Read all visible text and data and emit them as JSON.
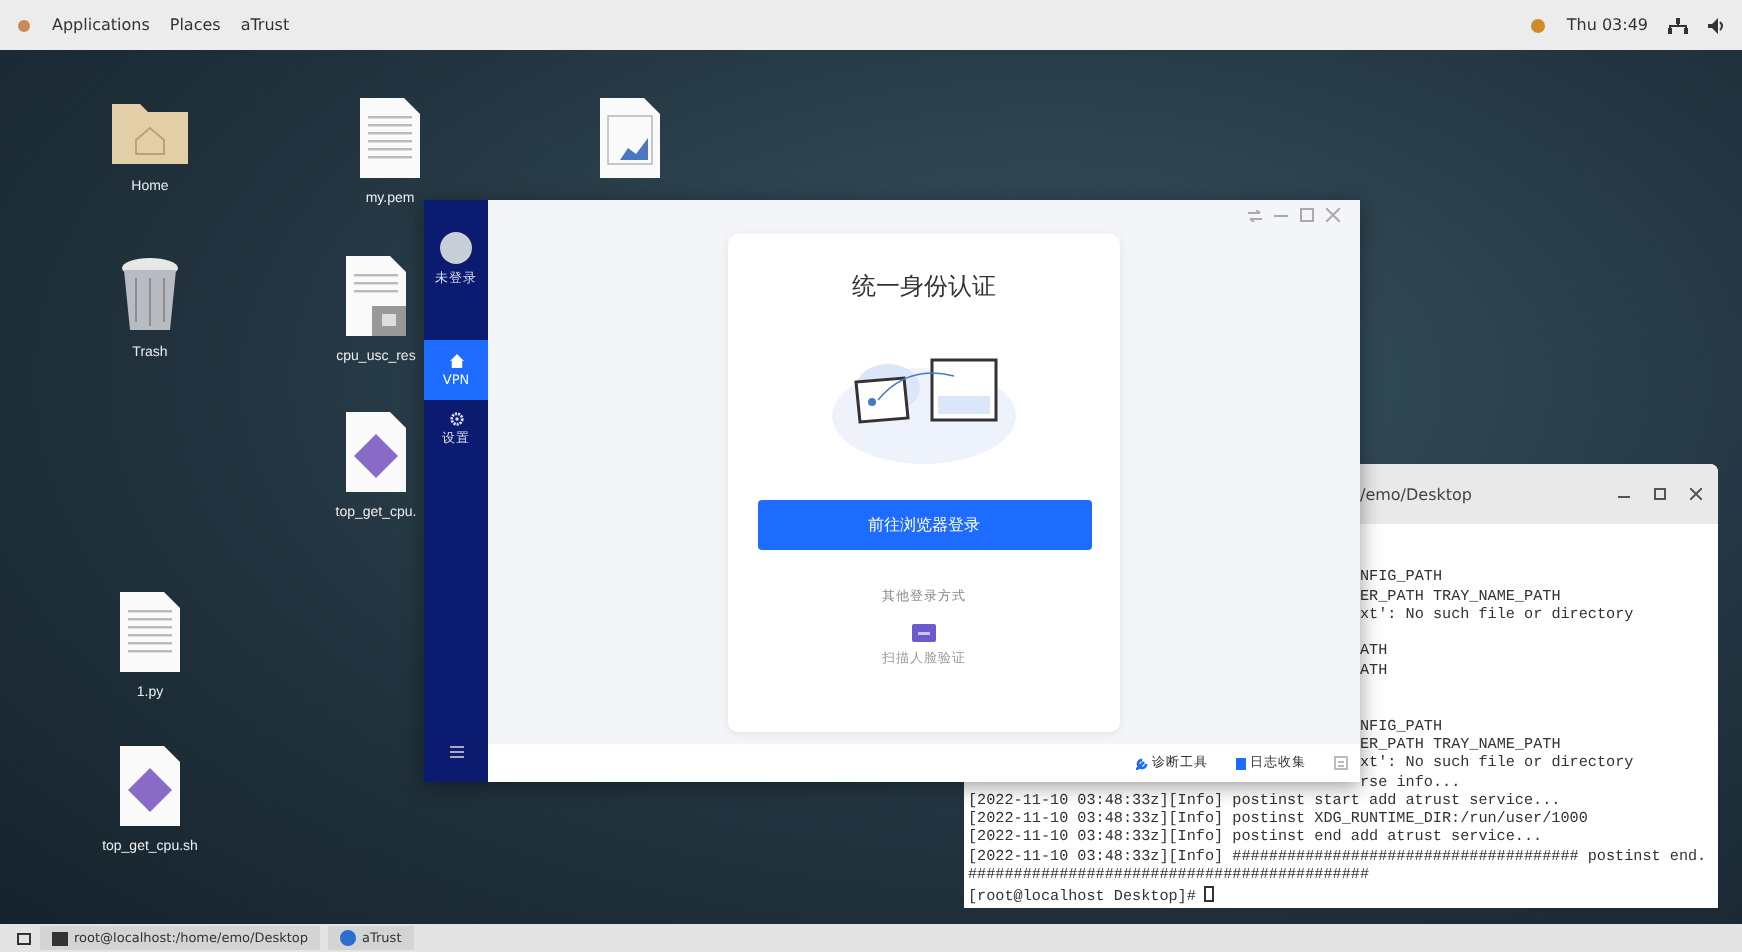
{
  "top_bar": {
    "menus": [
      "Applications",
      "Places",
      "aTrust"
    ],
    "clock": "Thu 03:49"
  },
  "desktop_icons": [
    {
      "kind": "folder",
      "label": "Home"
    },
    {
      "kind": "document",
      "label": "my.pem"
    },
    {
      "kind": "spreadsheet"
    },
    {
      "kind": "trash",
      "label": "Trash"
    },
    {
      "kind": "locked-document",
      "label": "cpu_usc_res"
    },
    {
      "kind": "script",
      "label": "top_get_cpu."
    },
    {
      "kind": "document",
      "label": "1.py"
    },
    {
      "kind": "script",
      "label": "top_get_cpu.sh"
    }
  ],
  "terminal": {
    "title": "/emo/Desktop",
    "lines": [
      {
        "kind": "blank"
      },
      {
        "kind": "partial",
        "text": "NFIG_PATH"
      },
      {
        "kind": "partial",
        "text": "ER_PATH TRAY_NAME_PATH"
      },
      {
        "kind": "partial",
        "text": "xt': No such file or directory"
      },
      {
        "kind": "blank"
      },
      {
        "kind": "partial",
        "text": "ATH"
      },
      {
        "kind": "partial",
        "text": "ATH"
      },
      {
        "kind": "blank"
      },
      {
        "kind": "blank"
      },
      {
        "kind": "partial",
        "text": "NFIG_PATH"
      },
      {
        "kind": "partial",
        "text": "ER_PATH TRAY_NAME_PATH"
      },
      {
        "kind": "partial",
        "text": "xt': No such file or directory"
      },
      {
        "kind": "partial",
        "text": "rse info..."
      },
      {
        "kind": "full",
        "text": "[2022-11-10 03:48:33z][Info] postinst start add atrust service..."
      },
      {
        "kind": "full",
        "text": "[2022-11-10 03:48:33z][Info] postinst XDG_RUNTIME_DIR:/run/user/1000"
      },
      {
        "kind": "full",
        "text": "[2022-11-10 03:48:33z][Info] postinst end add atrust service..."
      },
      {
        "kind": "full",
        "text": "[2022-11-10 03:48:33z][Info] ###################################### postinst end."
      },
      {
        "kind": "full",
        "text": "############################################"
      },
      {
        "kind": "prompt",
        "text": "[root@localhost Desktop]# "
      }
    ]
  },
  "atrust": {
    "sidebar": {
      "user": "未登录",
      "items": [
        {
          "kind": "home",
          "label": "VPN",
          "selected": true
        },
        {
          "kind": "gear",
          "label": "设置",
          "selected": false
        }
      ]
    },
    "card": {
      "title": "统一身份认证",
      "login_button": "前往浏览器登录",
      "other_label": "其他登录方式",
      "alt_method": "扫描人脸验证"
    },
    "footer": [
      "诊断工具",
      "日志收集"
    ]
  },
  "taskbar": [
    "root@localhost:/home/emo/Desktop",
    "aTrust"
  ]
}
